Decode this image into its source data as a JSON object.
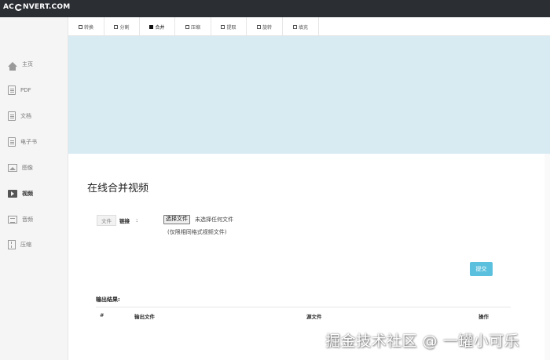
{
  "app": {
    "logo_text_left": "AC",
    "logo_text_right": "NVERT.COM"
  },
  "sidebar": {
    "items": [
      {
        "label": "主页",
        "icon": "home-icon"
      },
      {
        "label": "PDF",
        "icon": "pdf-file-icon"
      },
      {
        "label": "文档",
        "icon": "document-icon"
      },
      {
        "label": "电子书",
        "icon": "ebook-icon"
      },
      {
        "label": "图像",
        "icon": "image-icon"
      },
      {
        "label": "视频",
        "icon": "video-icon",
        "active": true
      },
      {
        "label": "音频",
        "icon": "audio-icon"
      },
      {
        "label": "压缩",
        "icon": "archive-icon"
      }
    ]
  },
  "tabs": [
    {
      "label": "转换"
    },
    {
      "label": "分割"
    },
    {
      "label": "合并",
      "active": true
    },
    {
      "label": "压缩"
    },
    {
      "label": "提取"
    },
    {
      "label": "旋转"
    },
    {
      "label": "填充"
    }
  ],
  "main": {
    "title": "在线合并视频",
    "source_toggle": {
      "file_label": "文件",
      "link_label": "链接",
      "colon": ":"
    },
    "file_input": {
      "button_label": "选择文件",
      "status": "未选择任何文件"
    },
    "hint": "(仅限相同格式视频文件)",
    "submit_label": "提交",
    "results": {
      "label": "输出结果:",
      "columns": [
        "#",
        "输出文件",
        "源文件",
        "操作"
      ]
    }
  },
  "watermark": "掘金技术社区 @ 一罐小可乐",
  "colors": {
    "topbar": "#2b2e33",
    "banner": "#d8ebf2",
    "submit": "#5bc0de",
    "sidebar": "#f5f5f5"
  }
}
